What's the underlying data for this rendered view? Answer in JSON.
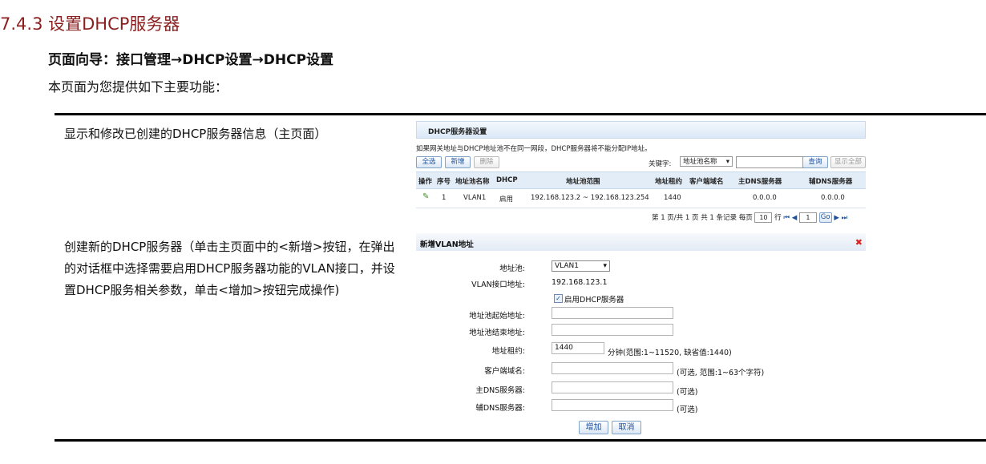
{
  "section_title": "7.4.3  设置DHCP服务器",
  "nav_path": "页面向导：接口管理→DHCP设置→DHCP设置",
  "intro": "本页面为您提供如下主要功能：",
  "rows": [
    {
      "description": "显示和修改已创建的DHCP服务器信息（主页面）"
    },
    {
      "description": "创建新的DHCP服务器（单击主页面中的<新增>按钮，在弹出的对话框中选择需要启用DHCP服务器功能的VLAN接口，并设置DHCP服务相关参数，单击<增加>按钮完成操作)"
    }
  ],
  "panel1": {
    "title": "DHCP服务器设置",
    "note": "如果网关地址与DHCP地址池不在同一网段，DHCP服务器将不能分配IP地址。",
    "buttons": {
      "select_all": "全选",
      "add": "新增",
      "delete": "删除",
      "search": "查询",
      "show_all": "显示全部"
    },
    "keyword_label": "关键字:",
    "keyword_select": "地址池名称",
    "columns": [
      "操作",
      "序号",
      "地址池名称",
      "DHCP",
      "地址池范围",
      "地址租约",
      "客户端域名",
      "主DNS服务器",
      "辅DNS服务器"
    ],
    "rows": [
      {
        "index": "1",
        "pool_name": "VLAN1",
        "dhcp": "启用",
        "range": "192.168.123.2 ~ 192.168.123.254",
        "lease": "1440",
        "domain": "",
        "dns1": "0.0.0.0",
        "dns2": "0.0.0.0"
      }
    ],
    "pager": {
      "text": "第 1 页/共 1 页 共 1 条记录 每页",
      "per_page": "10",
      "rows_label": "行",
      "page_input": "1",
      "go": "Go"
    }
  },
  "panel2": {
    "title": "新增VLAN地址",
    "fields": {
      "pool_label": "地址池:",
      "pool_value": "VLAN1",
      "vlan_ip_label": "VLAN接口地址:",
      "vlan_ip_value": "192.168.123.1",
      "enable_label": "启用DHCP服务器",
      "start_label": "地址池起始地址:",
      "end_label": "地址池结束地址:",
      "lease_label": "地址租约:",
      "lease_value": "1440",
      "lease_note": "分钟(范围:1~11520, 缺省值:1440)",
      "domain_label": "客户端域名:",
      "domain_note": "(可选, 范围:1~63个字符)",
      "dns1_label": "主DNS服务器:",
      "dns1_note": "(可选)",
      "dns2_label": "辅DNS服务器:",
      "dns2_note": "(可选)"
    },
    "buttons": {
      "add": "增加",
      "cancel": "取消"
    }
  }
}
